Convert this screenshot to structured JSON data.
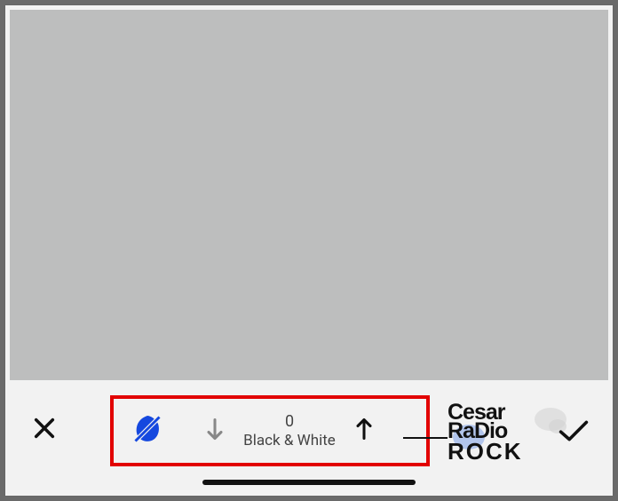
{
  "toolbar": {
    "close_label": "Close",
    "confirm_label": "Confirm"
  },
  "filter": {
    "value": "0",
    "name": "Black & White",
    "prev_label": "Previous",
    "next_label": "Next",
    "style_icon": "leaf"
  },
  "watermark": {
    "line1": "Cesar",
    "line2": "RaDio",
    "line3": "ROCK"
  },
  "colors": {
    "accent_red": "#e20000",
    "accent_blue": "#1548df",
    "background_grey": "#bdbebe"
  }
}
